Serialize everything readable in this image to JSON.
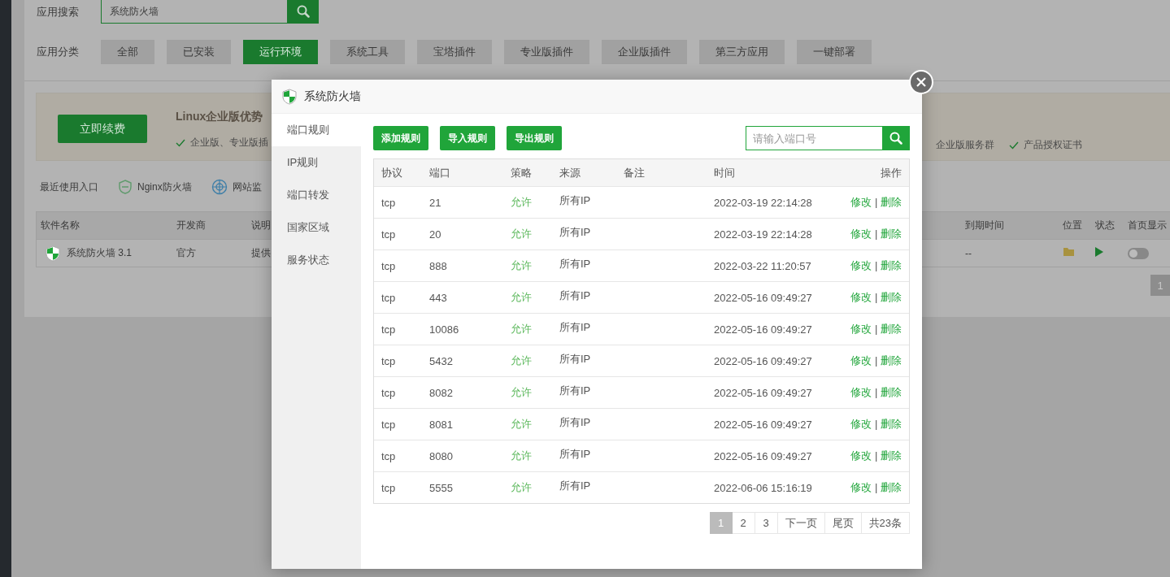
{
  "app_search": {
    "label": "应用搜索",
    "value": "系统防火墙"
  },
  "app_category": {
    "label": "应用分类",
    "items": [
      {
        "label": "全部",
        "selected": false
      },
      {
        "label": "已安装",
        "selected": false
      },
      {
        "label": "运行环境",
        "selected": true
      },
      {
        "label": "系统工具",
        "selected": false
      },
      {
        "label": "宝塔插件",
        "selected": false
      },
      {
        "label": "专业版插件",
        "selected": false
      },
      {
        "label": "企业版插件",
        "selected": false
      },
      {
        "label": "第三方应用",
        "selected": false
      },
      {
        "label": "一键部署",
        "selected": false
      }
    ]
  },
  "banner": {
    "button": "立即续费",
    "title": "Linux企业版优势",
    "features_left": [
      "企业版、专业版插"
    ],
    "features_right": [
      "企业版服务群",
      "产品授权证书"
    ]
  },
  "recent": {
    "label": "最近使用入口",
    "items": [
      {
        "label": "Nginx防火墙",
        "kind": "waf"
      },
      {
        "label": "网站监",
        "kind": "globe"
      }
    ]
  },
  "software_table": {
    "columns": [
      "软件名称",
      "开发商",
      "说明",
      "",
      "到期时间",
      "位置",
      "状态",
      "首页显示"
    ],
    "rows": [
      {
        "name": "系统防火墙 3.1",
        "developer": "官方",
        "description": "提供",
        "expiry": "--",
        "homepage_on": false
      }
    ],
    "pagination": [
      "1"
    ]
  },
  "dialog": {
    "title": "系统防火墙",
    "nav": [
      {
        "label": "端口规则",
        "selected": true
      },
      {
        "label": "IP规则",
        "selected": false
      },
      {
        "label": "端口转发",
        "selected": false
      },
      {
        "label": "国家区域",
        "selected": false
      },
      {
        "label": "服务状态",
        "selected": false
      }
    ],
    "buttons": [
      "添加规则",
      "导入规则",
      "导出规则"
    ],
    "search": {
      "placeholder": "请输入端口号"
    },
    "columns": [
      "协议",
      "端口",
      "策略",
      "来源",
      "备注",
      "时间",
      "操作"
    ],
    "rows": [
      {
        "protocol": "tcp",
        "port": "21",
        "policy": "允许",
        "source": "所有IP",
        "time": "2022-03-19 22:14:28",
        "actions": [
          "修改",
          "|",
          "删除"
        ]
      },
      {
        "protocol": "tcp",
        "port": "20",
        "policy": "允许",
        "source": "所有IP",
        "time": "2022-03-19 22:14:28",
        "actions": [
          "修改",
          "|",
          "删除"
        ]
      },
      {
        "protocol": "tcp",
        "port": "888",
        "policy": "允许",
        "source": "所有IP",
        "time": "2022-03-22 11:20:57",
        "actions": [
          "修改",
          "|",
          "删除"
        ]
      },
      {
        "protocol": "tcp",
        "port": "443",
        "policy": "允许",
        "source": "所有IP",
        "time": "2022-05-16 09:49:27",
        "actions": [
          "修改",
          "|",
          "删除"
        ]
      },
      {
        "protocol": "tcp",
        "port": "10086",
        "policy": "允许",
        "source": "所有IP",
        "time": "2022-05-16 09:49:27",
        "actions": [
          "修改",
          "|",
          "删除"
        ]
      },
      {
        "protocol": "tcp",
        "port": "5432",
        "policy": "允许",
        "source": "所有IP",
        "time": "2022-05-16 09:49:27",
        "actions": [
          "修改",
          "|",
          "删除"
        ]
      },
      {
        "protocol": "tcp",
        "port": "8082",
        "policy": "允许",
        "source": "所有IP",
        "time": "2022-05-16 09:49:27",
        "actions": [
          "修改",
          "|",
          "删除"
        ]
      },
      {
        "protocol": "tcp",
        "port": "8081",
        "policy": "允许",
        "source": "所有IP",
        "time": "2022-05-16 09:49:27",
        "actions": [
          "修改",
          "|",
          "删除"
        ]
      },
      {
        "protocol": "tcp",
        "port": "8080",
        "policy": "允许",
        "source": "所有IP",
        "time": "2022-05-16 09:49:27",
        "actions": [
          "修改",
          "|",
          "删除"
        ]
      },
      {
        "protocol": "tcp",
        "port": "5555",
        "policy": "允许",
        "source": "所有IP",
        "time": "2022-06-06 15:16:19",
        "actions": [
          "修改",
          "|",
          "删除"
        ]
      }
    ],
    "pagination": {
      "pages": [
        {
          "label": "1",
          "selected": true
        },
        {
          "label": "2",
          "selected": false
        },
        {
          "label": "3",
          "selected": false
        }
      ],
      "next": "下一页",
      "last": "尾页",
      "total": "共23条"
    }
  }
}
